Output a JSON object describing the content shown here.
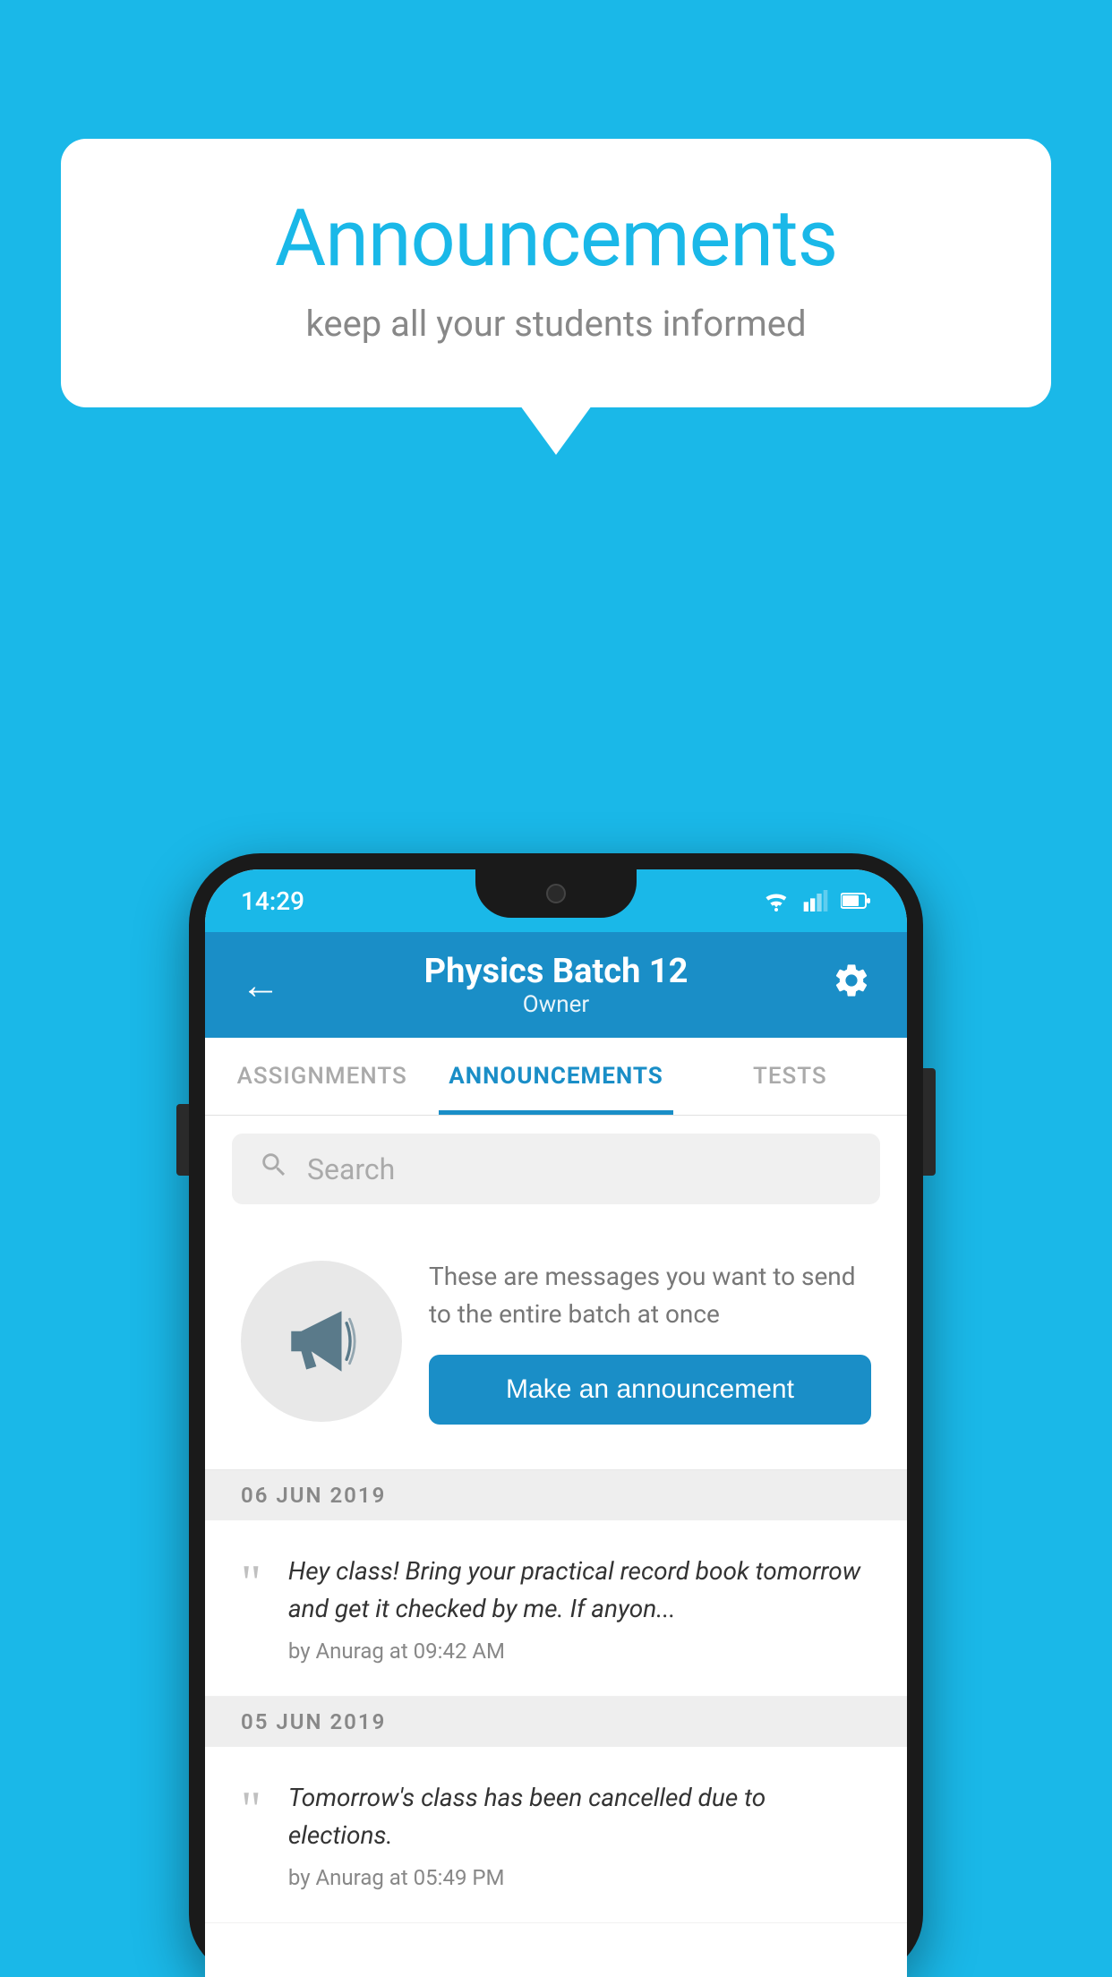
{
  "page": {
    "background_color": "#1ab8e8"
  },
  "speech_bubble": {
    "title": "Announcements",
    "subtitle": "keep all your students informed"
  },
  "status_bar": {
    "time": "14:29",
    "wifi_icon": "wifi",
    "signal_icon": "signal",
    "battery_icon": "battery"
  },
  "app_bar": {
    "back_label": "←",
    "title": "Physics Batch 12",
    "subtitle": "Owner",
    "settings_icon": "gear"
  },
  "tabs": [
    {
      "label": "ASSIGNMENTS",
      "active": false
    },
    {
      "label": "ANNOUNCEMENTS",
      "active": true
    },
    {
      "label": "TESTS",
      "active": false
    }
  ],
  "search": {
    "placeholder": "Search"
  },
  "promo": {
    "description": "These are messages you want to send to the entire batch at once",
    "button_label": "Make an announcement"
  },
  "announcements": [
    {
      "date": "06  JUN  2019",
      "message": "Hey class! Bring your practical record book tomorrow and get it checked by me. If anyon...",
      "author": "by Anurag at 09:42 AM"
    },
    {
      "date": "05  JUN  2019",
      "message": "Tomorrow's class has been cancelled due to elections.",
      "author": "by Anurag at 05:49 PM"
    }
  ]
}
